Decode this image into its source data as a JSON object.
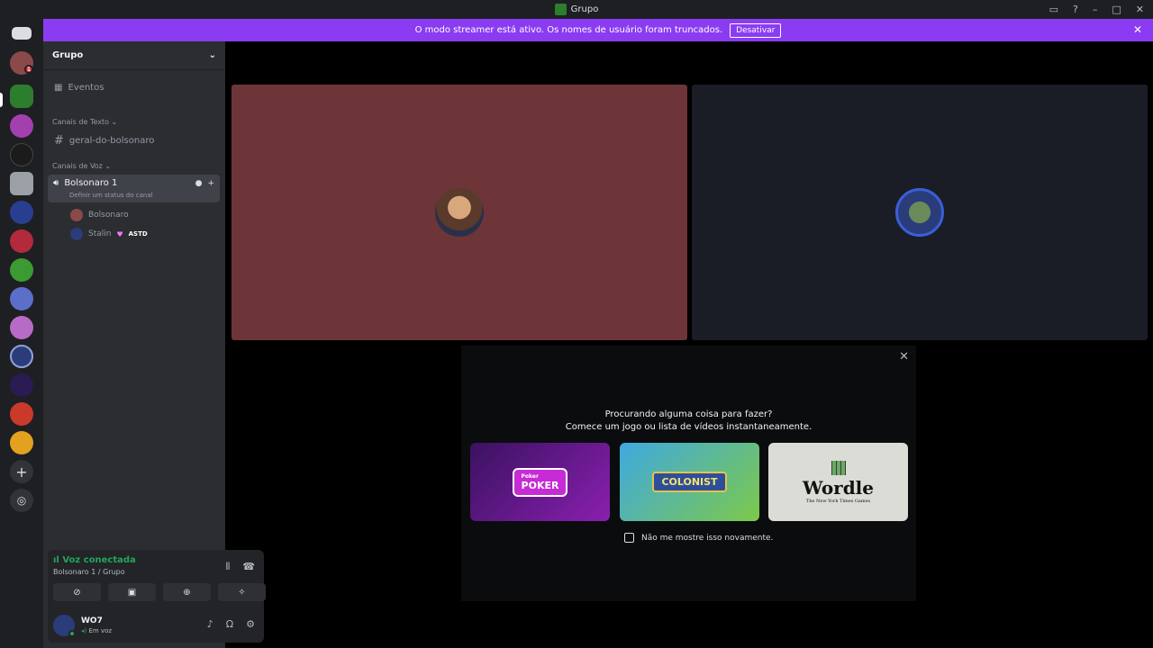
{
  "window": {
    "title": "Grupo"
  },
  "banner": {
    "message": "O modo streamer está ativo. Os nomes de usuário foram truncados.",
    "button": "Desativar"
  },
  "rail": {
    "dm_badge": "1"
  },
  "sidebar": {
    "server_name": "Grupo",
    "events": "Eventos",
    "text_category": "Canais de Texto",
    "text_channel": "geral-do-bolsonaro",
    "voice_category": "Canais de Voz",
    "voice_channel": "Bolsonaro 1",
    "voice_status": "Definir um status do canal",
    "members": [
      {
        "name": "Bolsonaro"
      },
      {
        "name": "Stalin",
        "tag": "ASTD"
      }
    ]
  },
  "voice_panel": {
    "status": "Voz conectada",
    "location": "Bolsonaro 1 / Grupo"
  },
  "user": {
    "name": "WO7",
    "status": "Em voz"
  },
  "activity": {
    "line1": "Procurando alguma coisa para fazer?",
    "line2": "Comece um jogo ou lista de vídeos instantaneamente.",
    "games": [
      {
        "name": "POKER",
        "prefix": "Poker"
      },
      {
        "name": "COLONIST"
      },
      {
        "name": "Wordle",
        "subtitle": "The New York Times Games"
      }
    ],
    "dont_show": "Não me mostre isso novamente."
  },
  "colors": {
    "accent": "#8b3cf2",
    "tile_left": "#6e3538",
    "tile_right": "#1a1d26",
    "voice_green": "#23a55a"
  },
  "icons": [
    "discord-icon",
    "help-icon",
    "inbox-icon",
    "speaker-icon",
    "hash-icon",
    "calendar-icon",
    "microphone-icon",
    "headphones-icon",
    "gear-icon",
    "close-icon",
    "chevron-down-icon",
    "waveform-icon",
    "disconnect-icon",
    "camera-off-icon",
    "screen-share-icon",
    "gamepad-icon",
    "soundboard-icon"
  ]
}
